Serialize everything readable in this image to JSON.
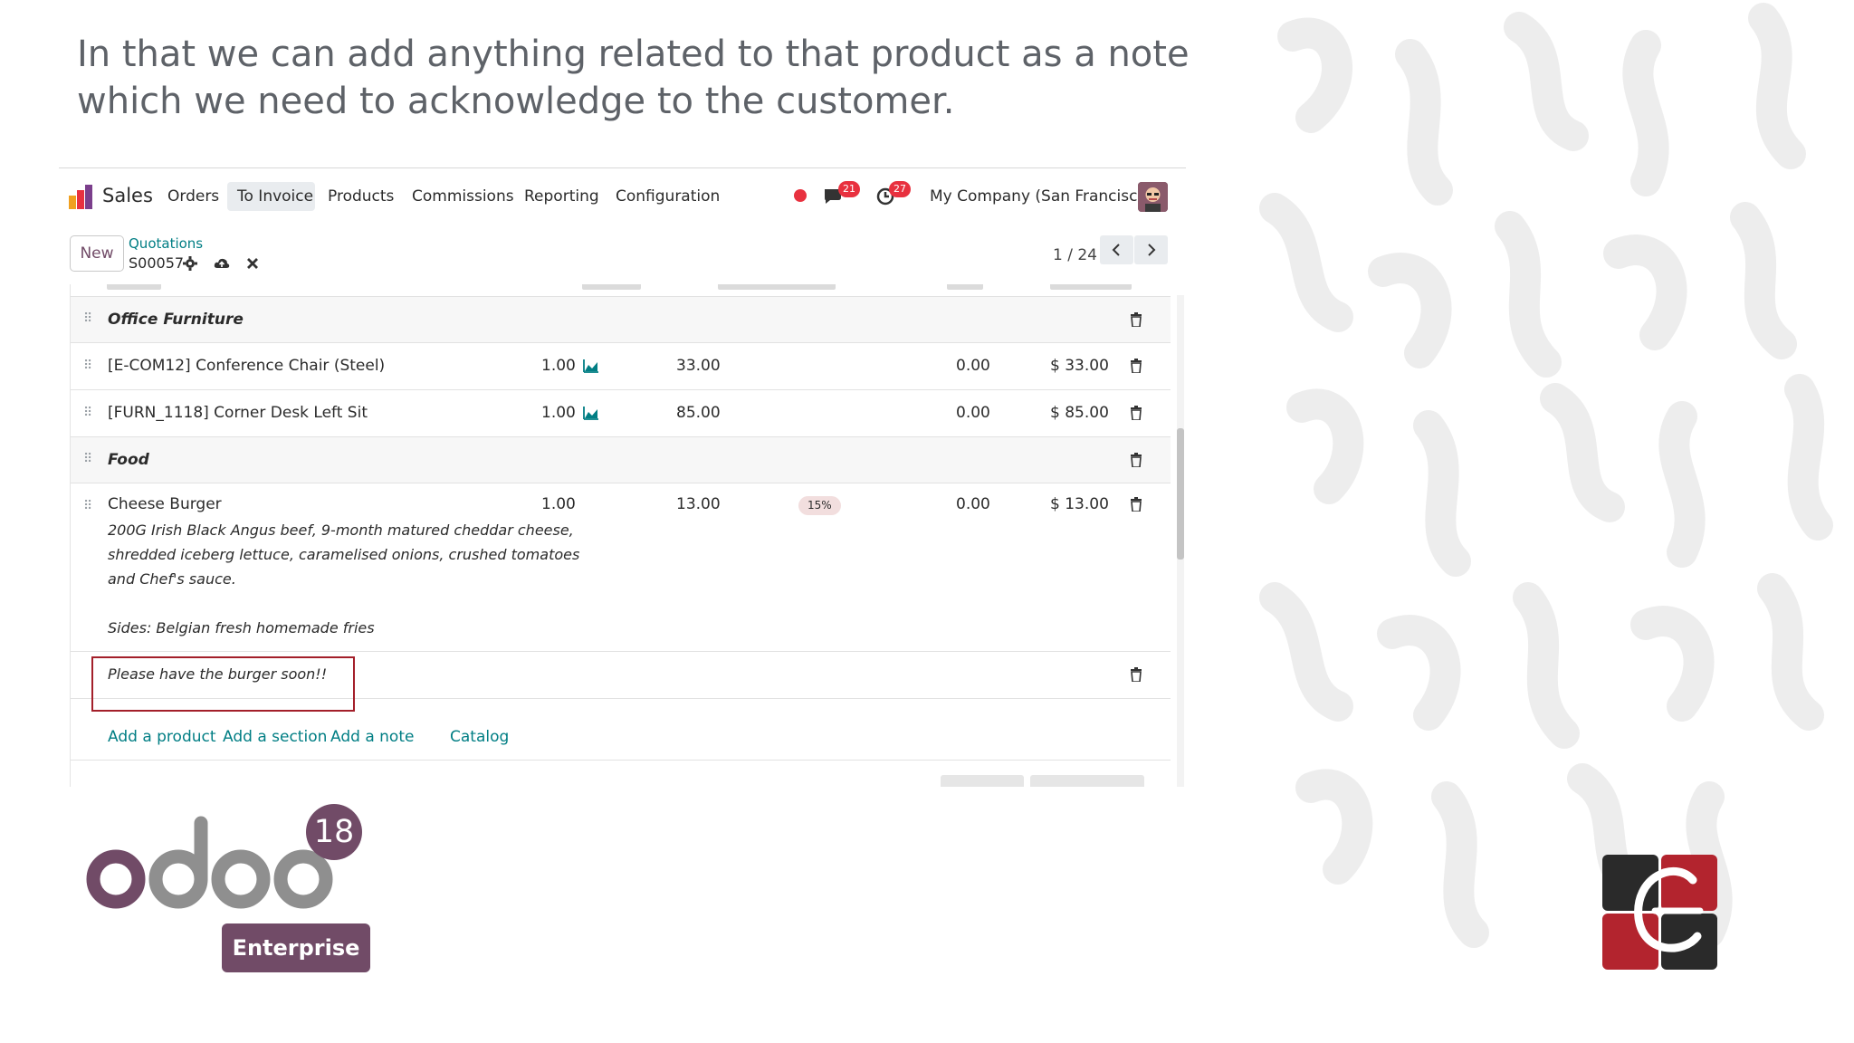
{
  "caption": "In that we can add anything related to that product as a note which we need to acknowledge to the customer.",
  "navbar": {
    "app_name": "Sales",
    "items": [
      "Orders",
      "To Invoice",
      "Products",
      "Commissions",
      "Reporting",
      "Configuration"
    ],
    "active_item": "To Invoice",
    "messages_count": "21",
    "activities_count": "27",
    "company": "My Company (San Francisco)"
  },
  "control_panel": {
    "new_label": "New",
    "breadcrumb_parent": "Quotations",
    "record_name": "S00057",
    "pager": "1 / 24"
  },
  "order_lines": {
    "rows": [
      {
        "type": "section",
        "name": "Office Furniture"
      },
      {
        "type": "product",
        "name": "[E-COM12] Conference Chair (Steel)",
        "quantity": "1.00",
        "unit_price": "33.00",
        "discount": "0.00",
        "amount": "$ 33.00"
      },
      {
        "type": "product",
        "name": "[FURN_1118] Corner Desk Left Sit",
        "quantity": "1.00",
        "unit_price": "85.00",
        "discount": "0.00",
        "amount": "$ 85.00"
      },
      {
        "type": "section",
        "name": "Food"
      },
      {
        "type": "product",
        "name": "Cheese Burger",
        "quantity": "1.00",
        "unit_price": "13.00",
        "tax": "15%",
        "discount": "0.00",
        "amount": "$ 13.00",
        "description": [
          "200G Irish Black Angus beef, 9-month matured cheddar cheese,",
          "shredded iceberg lettuce, caramelised onions, crushed tomatoes",
          "and Chef's sauce.",
          "Sides: Belgian fresh homemade fries"
        ]
      },
      {
        "type": "note",
        "name": "Please have the burger soon!!"
      }
    ],
    "add_links": {
      "product": "Add a product",
      "section": "Add a section",
      "note": "Add a note",
      "catalog": "Catalog"
    }
  },
  "branding": {
    "odoo_version": "18",
    "edition": "Enterprise",
    "logo_word": "odoo"
  },
  "colors": {
    "odoo_purple": "#714b67",
    "link_teal": "#017e84",
    "highlight_red": "#a31f2a",
    "badge_red": "#e8313f"
  },
  "icons": [
    "drag-handle-icon",
    "trash-icon",
    "chart-icon",
    "gear-icon",
    "cloud-upload-icon",
    "close-icon",
    "chat-icon",
    "clock-icon",
    "chevron-left-icon",
    "chevron-right-icon"
  ]
}
